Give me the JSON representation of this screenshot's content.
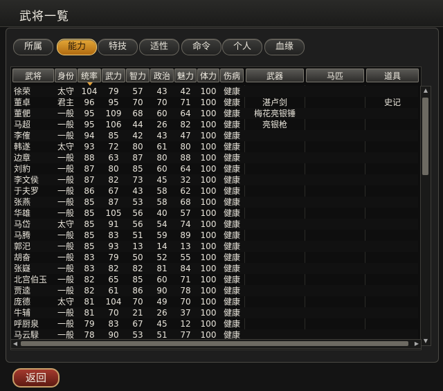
{
  "window": {
    "title": "武将一覧"
  },
  "tabs": [
    {
      "label": "所属",
      "active": false
    },
    {
      "label": "能力",
      "active": true
    },
    {
      "label": "特技",
      "active": false
    },
    {
      "label": "适性",
      "active": false
    },
    {
      "label": "命令",
      "active": false
    },
    {
      "label": "个人",
      "active": false
    },
    {
      "label": "血缘",
      "active": false
    }
  ],
  "columns": [
    "武将",
    "身份",
    "统率",
    "武力",
    "智力",
    "政治",
    "魅力",
    "体力",
    "伤病",
    "武器",
    "马匹",
    "道具"
  ],
  "sorted_column": "统率",
  "rows": [
    [
      "徐荣",
      "太守",
      "104",
      "79",
      "57",
      "43",
      "42",
      "100",
      "健康",
      "",
      "",
      ""
    ],
    [
      "董卓",
      "君主",
      "96",
      "95",
      "70",
      "70",
      "71",
      "100",
      "健康",
      "湛卢剑",
      "",
      "史记"
    ],
    [
      "董俷",
      "一般",
      "95",
      "109",
      "68",
      "60",
      "64",
      "100",
      "健康",
      "梅花亮银锤",
      "",
      ""
    ],
    [
      "马超",
      "一般",
      "95",
      "106",
      "44",
      "26",
      "82",
      "100",
      "健康",
      "亮银枪",
      "",
      ""
    ],
    [
      "李傕",
      "一般",
      "94",
      "85",
      "42",
      "43",
      "47",
      "100",
      "健康",
      "",
      "",
      ""
    ],
    [
      "韩遂",
      "太守",
      "93",
      "72",
      "80",
      "61",
      "80",
      "100",
      "健康",
      "",
      "",
      ""
    ],
    [
      "边章",
      "一般",
      "88",
      "63",
      "87",
      "80",
      "88",
      "100",
      "健康",
      "",
      "",
      ""
    ],
    [
      "刘豹",
      "一般",
      "87",
      "80",
      "85",
      "60",
      "64",
      "100",
      "健康",
      "",
      "",
      ""
    ],
    [
      "李文侯",
      "一般",
      "87",
      "82",
      "73",
      "45",
      "32",
      "100",
      "健康",
      "",
      "",
      ""
    ],
    [
      "于夫罗",
      "一般",
      "86",
      "67",
      "43",
      "58",
      "62",
      "100",
      "健康",
      "",
      "",
      ""
    ],
    [
      "张燕",
      "一般",
      "85",
      "87",
      "53",
      "58",
      "68",
      "100",
      "健康",
      "",
      "",
      ""
    ],
    [
      "华雄",
      "一般",
      "85",
      "105",
      "56",
      "40",
      "57",
      "100",
      "健康",
      "",
      "",
      ""
    ],
    [
      "马岱",
      "太守",
      "85",
      "91",
      "56",
      "54",
      "74",
      "100",
      "健康",
      "",
      "",
      ""
    ],
    [
      "马腾",
      "一般",
      "85",
      "83",
      "51",
      "59",
      "89",
      "100",
      "健康",
      "",
      "",
      ""
    ],
    [
      "郭汜",
      "一般",
      "85",
      "93",
      "13",
      "14",
      "13",
      "100",
      "健康",
      "",
      "",
      ""
    ],
    [
      "胡奋",
      "一般",
      "83",
      "79",
      "50",
      "52",
      "55",
      "100",
      "健康",
      "",
      "",
      ""
    ],
    [
      "张嶷",
      "一般",
      "83",
      "82",
      "82",
      "81",
      "84",
      "100",
      "健康",
      "",
      "",
      ""
    ],
    [
      "北宫伯玉",
      "一般",
      "82",
      "65",
      "85",
      "60",
      "71",
      "100",
      "健康",
      "",
      "",
      ""
    ],
    [
      "贾逵",
      "一般",
      "82",
      "61",
      "86",
      "90",
      "78",
      "100",
      "健康",
      "",
      "",
      ""
    ],
    [
      "庞德",
      "太守",
      "81",
      "104",
      "70",
      "49",
      "70",
      "100",
      "健康",
      "",
      "",
      ""
    ],
    [
      "牛辅",
      "一般",
      "81",
      "70",
      "21",
      "26",
      "37",
      "100",
      "健康",
      "",
      "",
      ""
    ],
    [
      "呼厨泉",
      "一般",
      "79",
      "83",
      "67",
      "45",
      "12",
      "100",
      "健康",
      "",
      "",
      ""
    ],
    [
      "马云騄",
      "一般",
      "78",
      "90",
      "53",
      "51",
      "77",
      "100",
      "健康",
      "",
      "",
      ""
    ]
  ],
  "footer": {
    "back_label": "返回"
  }
}
